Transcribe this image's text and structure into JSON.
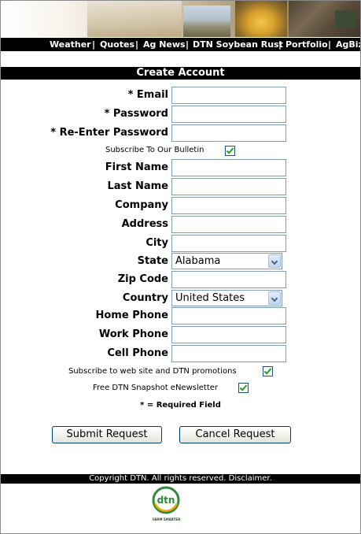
{
  "nav": {
    "items": [
      {
        "label": "Weather"
      },
      {
        "label": "Quotes"
      },
      {
        "label": "Ag News"
      },
      {
        "label": "DTN Soybean Rust"
      },
      {
        "label": "Portfolio"
      },
      {
        "label": "AgBiz"
      }
    ],
    "separator": "|"
  },
  "form": {
    "title": "Create Account",
    "labels": {
      "email": "* Email",
      "password": "* Password",
      "reenter_password": "* Re-Enter Password",
      "subscribe_bulletin": "Subscribe To Our Bulletin",
      "first_name": "First Name",
      "last_name": "Last Name",
      "company": "Company",
      "address": "Address",
      "city": "City",
      "state": "State",
      "zip": "Zip Code",
      "country": "Country",
      "home_phone": "Home Phone",
      "work_phone": "Work Phone",
      "cell_phone": "Cell Phone",
      "subscribe_promos": "Subscribe to web site and DTN promotions",
      "free_newsletter": "Free DTN Snapshot eNewsletter"
    },
    "values": {
      "state": "Alabama",
      "country": "United States"
    },
    "checked": {
      "subscribe_bulletin": true,
      "subscribe_promos": true,
      "free_newsletter": true
    },
    "required_note": "*  =  Required Field",
    "submit_label": "Submit Request",
    "cancel_label": "Cancel Request"
  },
  "footer": {
    "text": "Copyright DTN. All rights reserved. Disclaimer.",
    "logo_text": "dtn",
    "logo_tagline": "FARM SMARTER"
  },
  "colors": {
    "bar_bg": "#000000",
    "bar_text": "#ffffff",
    "input_border": "#7f9db9",
    "check_color": "#21a121",
    "logo_green": "#2e8b3a"
  }
}
